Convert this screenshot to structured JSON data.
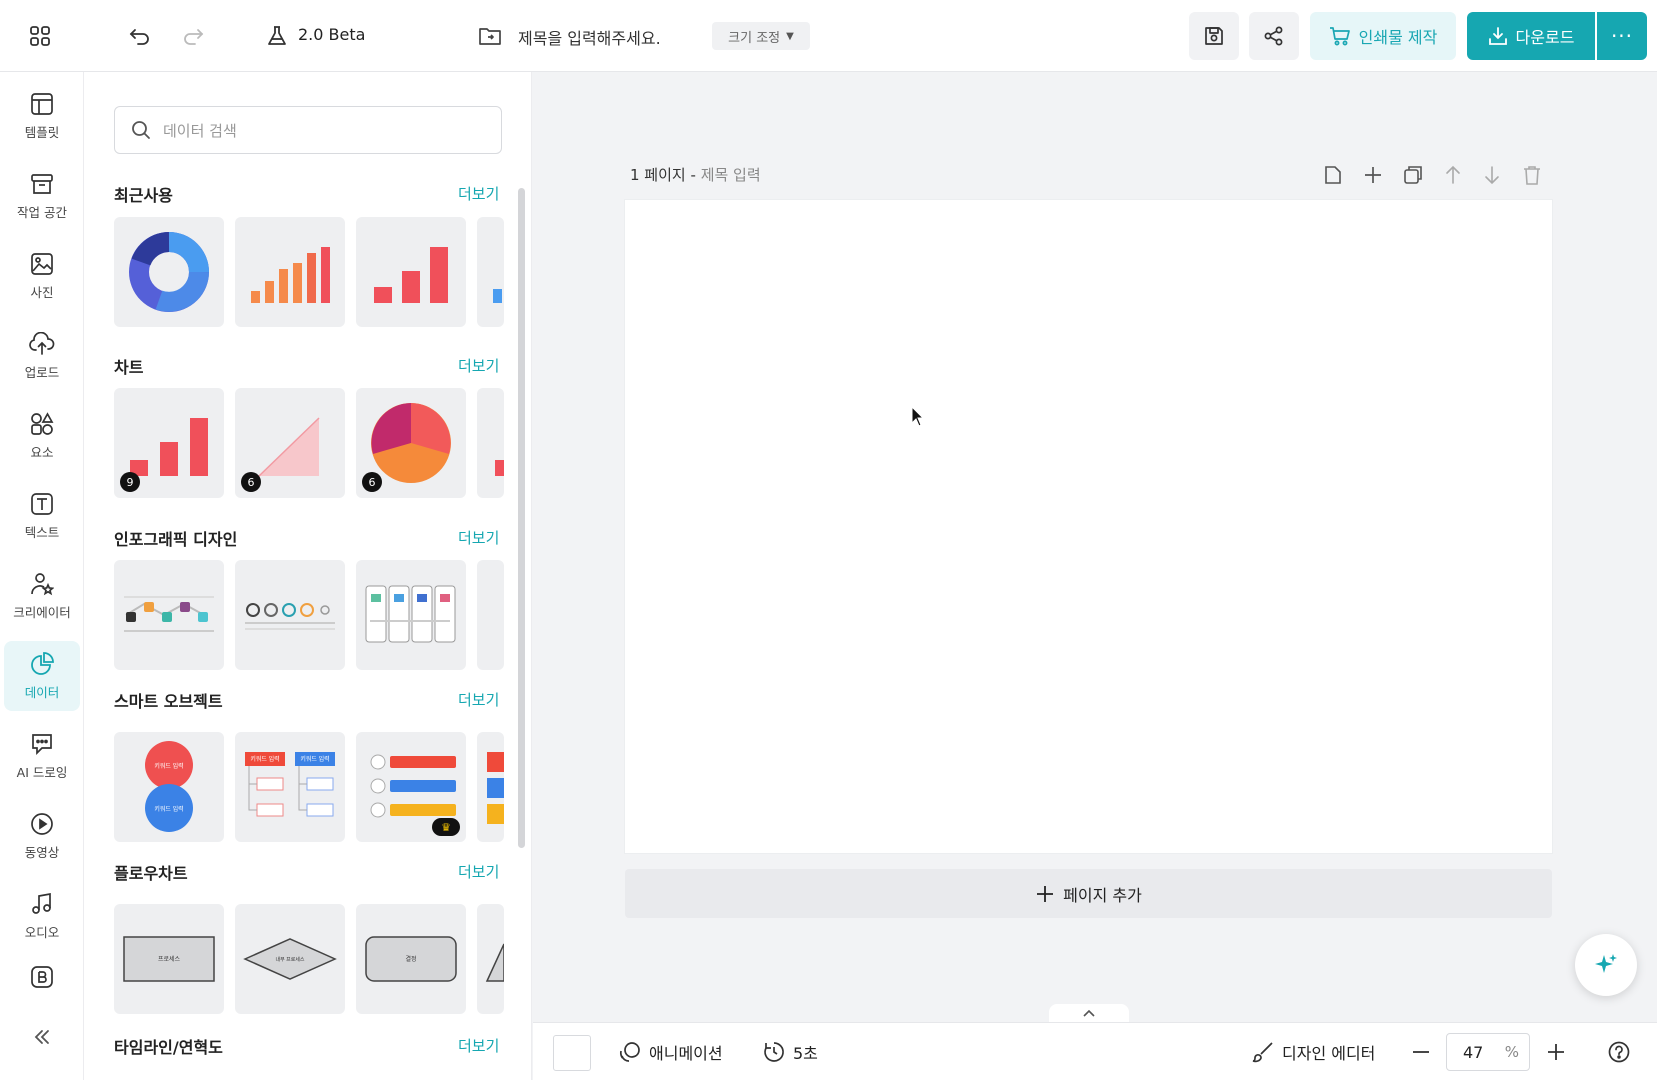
{
  "topbar": {
    "version": "2.0 Beta",
    "title_placeholder": "제목을 입력해주세요.",
    "resize_label": "크기 조정",
    "print_label": "인쇄물 제작",
    "download_label": "다운로드",
    "more_label": "···"
  },
  "rail": {
    "items": [
      {
        "label": "템플릿",
        "icon": "template-icon"
      },
      {
        "label": "작업 공간",
        "icon": "workspace-icon"
      },
      {
        "label": "사진",
        "icon": "photo-icon"
      },
      {
        "label": "업로드",
        "icon": "upload-icon"
      },
      {
        "label": "요소",
        "icon": "elements-icon"
      },
      {
        "label": "텍스트",
        "icon": "text-icon"
      },
      {
        "label": "크리에이터",
        "icon": "creator-icon"
      },
      {
        "label": "데이터",
        "icon": "data-icon",
        "active": true
      },
      {
        "label": "AI 드로잉",
        "icon": "ai-drawing-icon"
      },
      {
        "label": "동영상",
        "icon": "video-icon"
      },
      {
        "label": "오디오",
        "icon": "audio-icon"
      }
    ]
  },
  "panel": {
    "search_placeholder": "데이터 검색",
    "more_label": "더보기",
    "sections": {
      "recent": "최근사용",
      "chart": "차트",
      "infographic": "인포그래픽 디자인",
      "smart": "스마트 오브젝트",
      "flowchart": "플로우차트",
      "timeline": "타임라인/연혁도"
    },
    "chart_badges": [
      "9",
      "6",
      "6"
    ],
    "smart_thumb_texts": [
      "키워드 입력",
      "키워드 입력",
      "키워드 입력",
      "키워드 입력"
    ],
    "flow_thumb_texts": [
      "프로세스",
      "내부 프로세스",
      "결정"
    ]
  },
  "canvas": {
    "page_label": "1 페이지 -",
    "page_title_placeholder": "제목 입력",
    "add_page_label": "페이지 추가"
  },
  "bottombar": {
    "animation_label": "애니메이션",
    "duration_label": "5초",
    "design_editor_label": "디자인 에디터",
    "zoom_value": "47",
    "zoom_unit": "%"
  },
  "colors": {
    "accent": "#16a7b1",
    "accent_light": "#e6f6f8",
    "bar_orange": "#f58a4b",
    "bar_red": "#f0505a",
    "donut_navy": "#2d3a9a",
    "donut_blue": "#4a9cf0"
  }
}
